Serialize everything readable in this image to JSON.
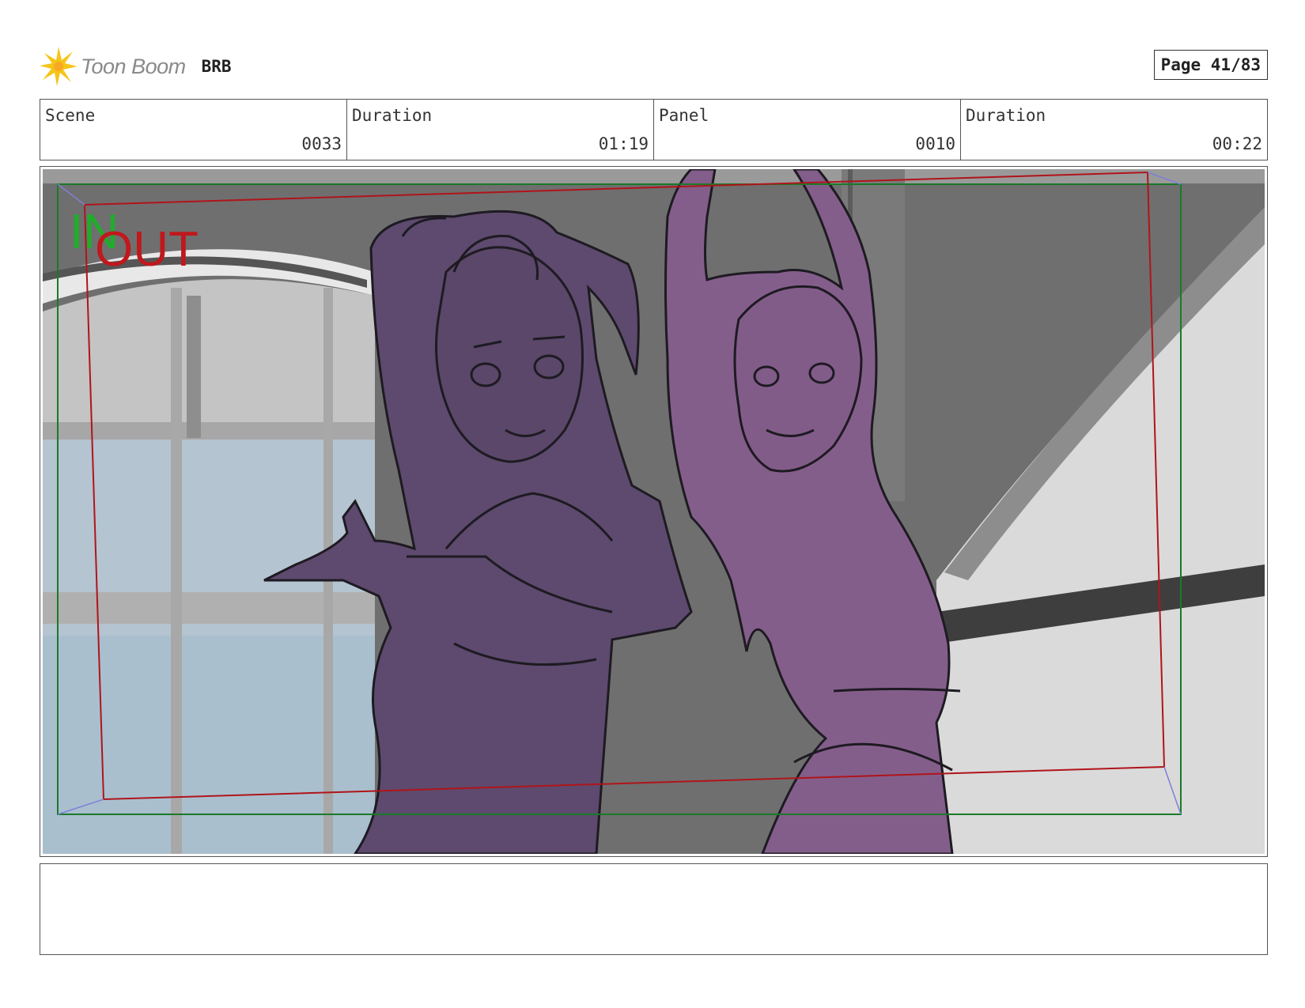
{
  "header": {
    "brand": "Toon Boom",
    "project": "BRB",
    "page": "Page 41/83",
    "logo_icon": "toon-boom-burst-icon",
    "logo_color": "#f5c518"
  },
  "info": {
    "scene_label": "Scene",
    "scene_value": "0033",
    "scene_duration_label": "Duration",
    "scene_duration_value": "01:19",
    "panel_label": "Panel",
    "panel_value": "0010",
    "panel_duration_label": "Duration",
    "panel_duration_value": "00:22"
  },
  "panel": {
    "in_label": "IN",
    "out_label": "OUT",
    "in_color": "#1fae2a",
    "out_color": "#c0181c",
    "character_left_color": "#5d4a6e",
    "character_right_color": "#845e8b"
  },
  "notes": {
    "text": ""
  }
}
